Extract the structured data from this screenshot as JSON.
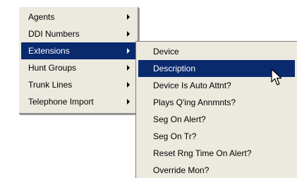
{
  "main_menu": {
    "items": [
      {
        "label": "Agents",
        "has_submenu": true,
        "highlighted": false
      },
      {
        "label": "DDI Numbers",
        "has_submenu": true,
        "highlighted": false
      },
      {
        "label": "Extensions",
        "has_submenu": true,
        "highlighted": true
      },
      {
        "label": "Hunt Groups",
        "has_submenu": true,
        "highlighted": false
      },
      {
        "label": "Trunk Lines",
        "has_submenu": true,
        "highlighted": false
      },
      {
        "label": "Telephone Import",
        "has_submenu": true,
        "highlighted": false
      }
    ]
  },
  "sub_menu": {
    "items": [
      {
        "label": "Device",
        "highlighted": false
      },
      {
        "label": "Description",
        "highlighted": true
      },
      {
        "label": "Device Is Auto Attnt?",
        "highlighted": false
      },
      {
        "label": "Plays Q'ing Annmnts?",
        "highlighted": false
      },
      {
        "label": "Seg On Alert?",
        "highlighted": false
      },
      {
        "label": "Seg On Tr?",
        "highlighted": false
      },
      {
        "label": "Reset Rng Time On Alert?",
        "highlighted": false
      },
      {
        "label": "Override Mon?",
        "highlighted": false
      }
    ]
  },
  "colors": {
    "menu_background": "#ece9df",
    "highlight": "#0a2a6e",
    "highlight_text": "#ffffff"
  },
  "icons": {
    "submenu_arrow": "chevron-right-icon",
    "cursor": "mouse-pointer-icon"
  }
}
